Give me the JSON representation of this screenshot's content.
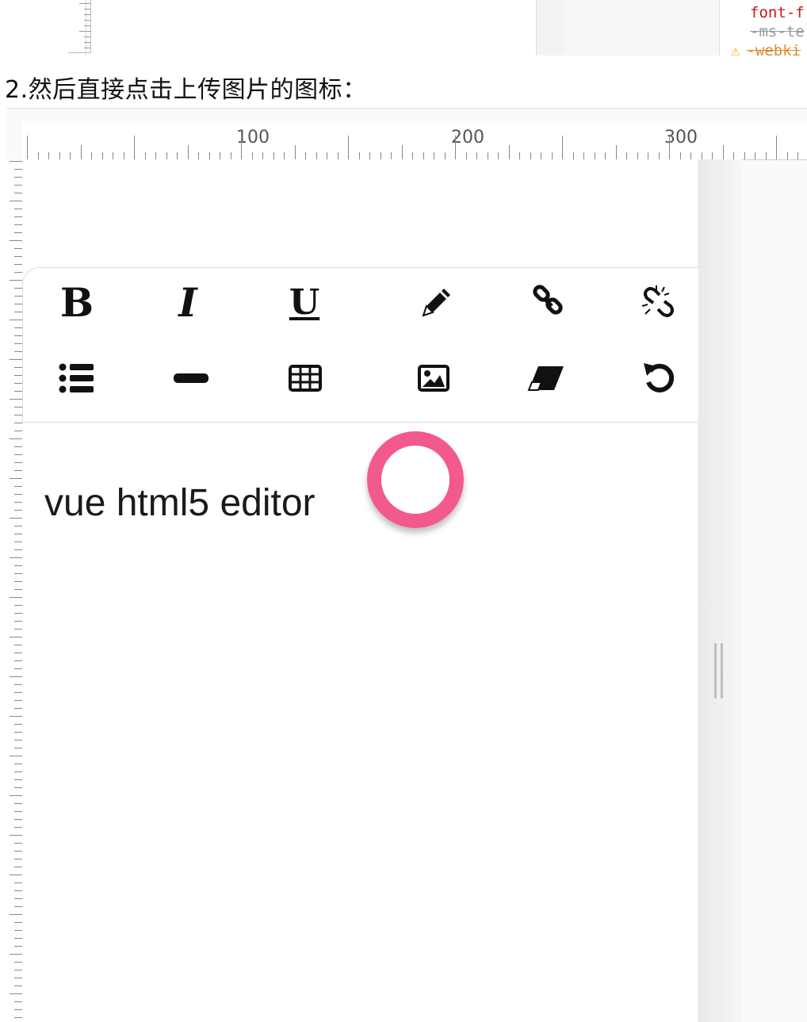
{
  "top_strip": {
    "code_lines": [
      "font-f",
      "-ms-te",
      "-webki"
    ]
  },
  "caption": "2.然后直接点击上传图片的图标：",
  "ruler": {
    "labels": [
      "100",
      "200",
      "300"
    ]
  },
  "toolbar": {
    "bold_label": "B",
    "italic_label": "I",
    "underline_label": "U",
    "items": [
      {
        "name": "bold",
        "icon": "bold-icon"
      },
      {
        "name": "italic",
        "icon": "italic-icon"
      },
      {
        "name": "underline",
        "icon": "underline-icon"
      },
      {
        "name": "color",
        "icon": "pencil-icon"
      },
      {
        "name": "link",
        "icon": "link-icon"
      },
      {
        "name": "unlink",
        "icon": "unlink-icon"
      },
      {
        "name": "list",
        "icon": "list-icon"
      },
      {
        "name": "hr",
        "icon": "horizontal-rule-icon"
      },
      {
        "name": "table",
        "icon": "table-icon"
      },
      {
        "name": "image",
        "icon": "image-icon"
      },
      {
        "name": "eraser",
        "icon": "eraser-icon"
      },
      {
        "name": "undo",
        "icon": "undo-icon"
      }
    ]
  },
  "highlight": {
    "target": "image",
    "color": "#f25a8e"
  },
  "editor": {
    "content": "vue html5 editor"
  }
}
